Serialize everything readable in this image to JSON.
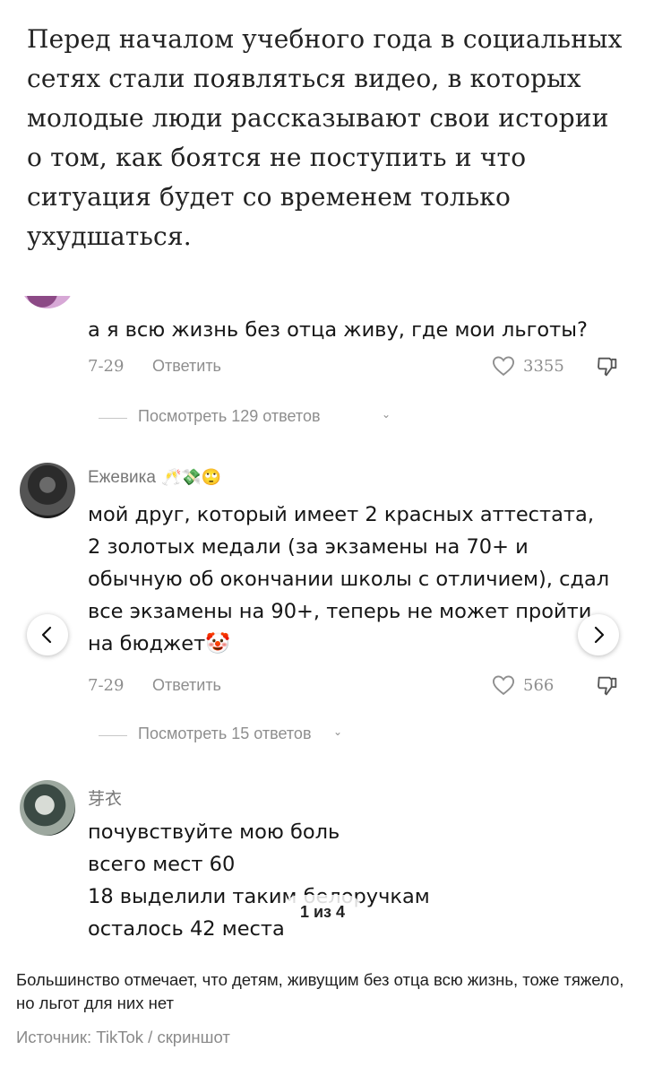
{
  "article": {
    "intro": "Перед началом учебного года в социальных сетях стали появляться видео, в которых молодые люди рассказывают свои истории о том, как боятся не поступить и что ситуация будет со временем только ухудшаться.",
    "caption": "Большинство отмечает, что детям, живущим без отца всю жизнь, тоже тяжело, но льгот для них нет",
    "source": "Источник: TikTok / скриншот"
  },
  "gallery": {
    "counter": "1 из 4",
    "prev_icon": "chevron-left-icon",
    "next_icon": "chevron-right-icon",
    "comments": [
      {
        "author": "",
        "text": "а я всю жизнь без отца живу, где мои льготы?",
        "date": "7-29",
        "reply_label": "Ответить",
        "likes": "3355",
        "view_replies": "Посмотреть 129 ответов"
      },
      {
        "author": "Ежевика",
        "author_emoji": "🥂💸🙄",
        "text_lines": [
          "мой друг, который имеет 2 красных аттестата,",
          "2 золотых медали (за экзамены на 70+ и",
          "обычную об окончании школы с отличием), сдал",
          "все экзамены на 90+, теперь не может пройти",
          "на бюджет🤡"
        ],
        "date": "7-29",
        "reply_label": "Ответить",
        "likes": "566",
        "view_replies": "Посмотреть 15 ответов"
      },
      {
        "author": "芽衣",
        "text_lines": [
          "почувствуйте мою боль",
          "всего мест 60",
          "18 выделили таким белоручкам",
          "осталось 42 места"
        ]
      }
    ]
  },
  "colors": {
    "muted_text": "#8e8e8e",
    "body_text": "#161616"
  }
}
